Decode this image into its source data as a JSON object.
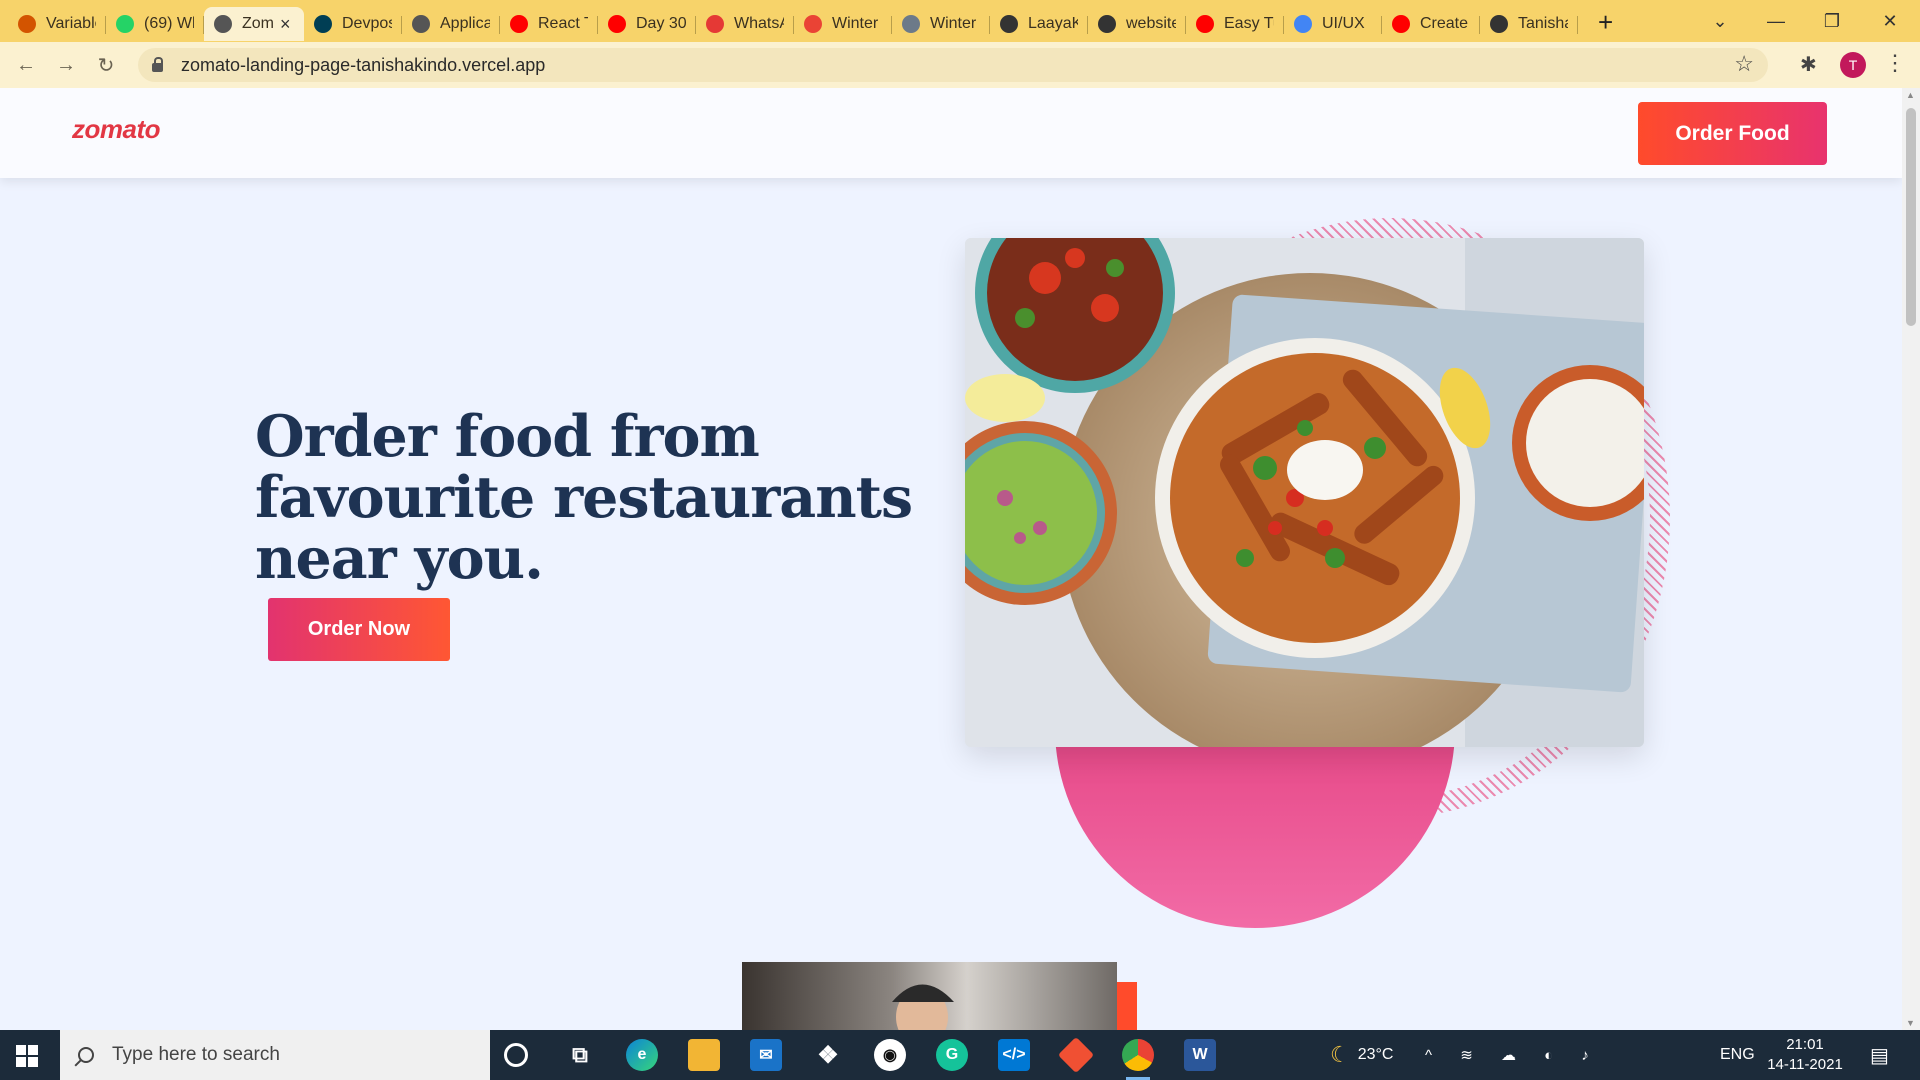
{
  "browser": {
    "tabs": [
      {
        "title": "Variable",
        "icon": "avatar-icon",
        "color": "#d35400"
      },
      {
        "title": "(69) Wh",
        "icon": "whatsapp-icon",
        "color": "#25d366"
      },
      {
        "title": "Zom",
        "icon": "globe-icon",
        "color": "#555555",
        "active": true
      },
      {
        "title": "Devpost",
        "icon": "devpost-icon",
        "color": "#003e54"
      },
      {
        "title": "Applica",
        "icon": "globe-icon",
        "color": "#555555"
      },
      {
        "title": "React T",
        "icon": "youtube-icon",
        "color": "#ff0000"
      },
      {
        "title": "Day 30",
        "icon": "youtube-icon",
        "color": "#ff0000"
      },
      {
        "title": "WhatsA",
        "icon": "alert-icon",
        "color": "#e53935"
      },
      {
        "title": "Winter",
        "icon": "gmail-icon",
        "color": "#ea4335"
      },
      {
        "title": "Winter",
        "icon": "gear-icon",
        "color": "#6c7a89"
      },
      {
        "title": "LaayaK",
        "icon": "github-icon",
        "color": "#333333"
      },
      {
        "title": "website",
        "icon": "github-icon",
        "color": "#333333"
      },
      {
        "title": "Easy Tu",
        "icon": "youtube-icon",
        "color": "#ff0000"
      },
      {
        "title": "UI/UX",
        "icon": "google-icon",
        "color": "#4285f4"
      },
      {
        "title": "Create",
        "icon": "youtube-icon",
        "color": "#ff0000"
      },
      {
        "title": "Tanisha",
        "icon": "github-icon",
        "color": "#333333"
      }
    ],
    "new_tab": "+",
    "url": "zomato-landing-page-tanishakindo.vercel.app",
    "profile_initial": "T"
  },
  "page": {
    "brand": "zomato",
    "header_button": "Order Food",
    "hero_title": "Order food from favourite restaurants near you.",
    "cta_button": "Order Now",
    "brand_color": "#e23744",
    "accent_gradient": [
      "#ff4b2b",
      "#e8336e"
    ]
  },
  "taskbar": {
    "search_placeholder": "Type here to search",
    "weather": "23°C",
    "language": "ENG",
    "time": "21:01",
    "date": "14-11-2021"
  }
}
